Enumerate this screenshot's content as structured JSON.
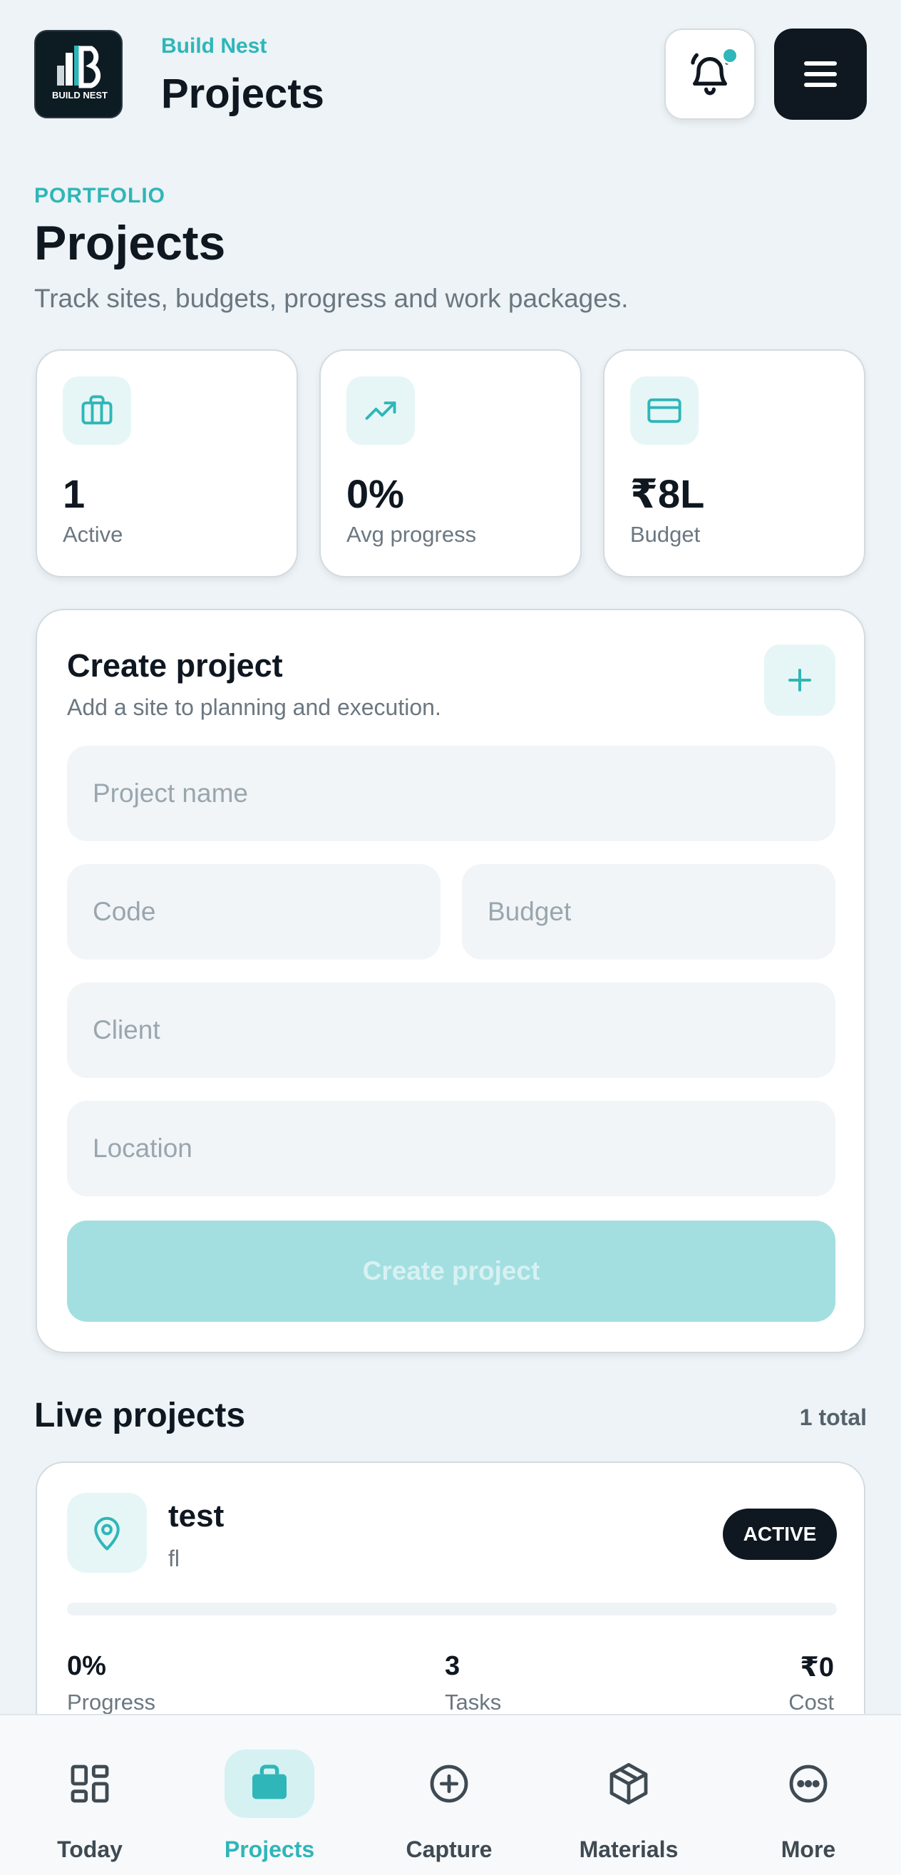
{
  "header": {
    "logo_text": "BUILD NEST",
    "brand": "Build Nest",
    "title": "Projects",
    "notification_icon": "bell-icon",
    "menu_icon": "hamburger-icon"
  },
  "intro": {
    "eyebrow": "PORTFOLIO",
    "title": "Projects",
    "subtitle": "Track sites, budgets, progress and work packages."
  },
  "stats": [
    {
      "icon": "briefcase-icon",
      "value": "1",
      "label": "Active"
    },
    {
      "icon": "trending-up-icon",
      "value": "0%",
      "label": "Avg progress"
    },
    {
      "icon": "credit-card-icon",
      "value": "₹8L",
      "label": "Budget"
    }
  ],
  "create": {
    "title": "Create project",
    "subtitle": "Add a site to planning and execution.",
    "fields": {
      "name_placeholder": "Project name",
      "code_placeholder": "Code",
      "budget_placeholder": "Budget",
      "client_placeholder": "Client",
      "location_placeholder": "Location"
    },
    "submit_label": "Create project"
  },
  "live": {
    "title": "Live projects",
    "count": "1 total",
    "projects": [
      {
        "name": "test",
        "code": "fl",
        "status": "ACTIVE",
        "progress_fraction": 0,
        "metrics": [
          {
            "value": "0%",
            "label": "Progress"
          },
          {
            "value": "3",
            "label": "Tasks"
          },
          {
            "value": "₹0",
            "label": "Cost"
          }
        ]
      }
    ]
  },
  "nav": [
    {
      "icon": "dashboard-icon",
      "label": "Today",
      "active": false
    },
    {
      "icon": "briefcase-icon",
      "label": "Projects",
      "active": true
    },
    {
      "icon": "plus-circle-icon",
      "label": "Capture",
      "active": false
    },
    {
      "icon": "package-icon",
      "label": "Materials",
      "active": false
    },
    {
      "icon": "more-icon",
      "label": "More",
      "active": false
    }
  ],
  "colors": {
    "accent": "#2fb6b8",
    "dark": "#0f1720",
    "background": "#edf3f6"
  }
}
